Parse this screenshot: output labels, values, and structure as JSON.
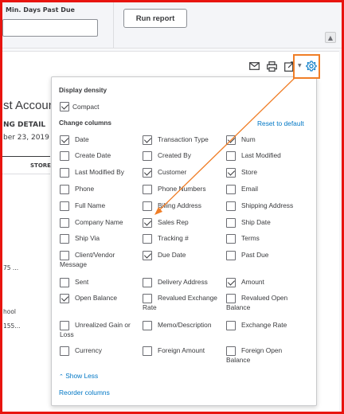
{
  "filters": {
    "min_days_label": "Min. Days Past Due",
    "min_days_value": "",
    "run_report_label": "Run report"
  },
  "toolbar": {
    "icons": [
      "email-icon",
      "print-icon",
      "export-icon",
      "settings-icon"
    ],
    "scroll_up_glyph": "▲"
  },
  "report": {
    "title_fragment": "st Accoun",
    "subtitle_fragment": "NG DETAIL",
    "date_fragment": "ber 23, 2019",
    "column_store": "STORE",
    "cell_1": "75 ...",
    "cell_2": "hool",
    "cell_3": "155..."
  },
  "popup": {
    "display_density_title": "Display density",
    "compact_label": "Compact",
    "compact_checked": true,
    "change_columns_title": "Change columns",
    "reset_label": "Reset to default",
    "show_less_label": "Show Less",
    "reorder_label": "Reorder columns",
    "options": [
      {
        "label": "Date",
        "checked": true
      },
      {
        "label": "Transaction Type",
        "checked": true
      },
      {
        "label": "Num",
        "checked": true
      },
      {
        "label": "Create Date",
        "checked": false
      },
      {
        "label": "Created By",
        "checked": false
      },
      {
        "label": "Last Modified",
        "checked": false
      },
      {
        "label": "Last Modified By",
        "checked": false
      },
      {
        "label": "Customer",
        "checked": true
      },
      {
        "label": "Store",
        "checked": true
      },
      {
        "label": "Phone",
        "checked": false
      },
      {
        "label": "Phone Numbers",
        "checked": false
      },
      {
        "label": "Email",
        "checked": false
      },
      {
        "label": "Full Name",
        "checked": false
      },
      {
        "label": "Billing Address",
        "checked": false
      },
      {
        "label": "Shipping Address",
        "checked": false
      },
      {
        "label": "Company Name",
        "checked": false
      },
      {
        "label": "Sales Rep",
        "checked": true
      },
      {
        "label": "Ship Date",
        "checked": false
      },
      {
        "label": "Ship Via",
        "checked": false
      },
      {
        "label": "Tracking #",
        "checked": false
      },
      {
        "label": "Terms",
        "checked": false
      },
      {
        "label": "Client/Vendor Message",
        "checked": false
      },
      {
        "label": "Due Date",
        "checked": true
      },
      {
        "label": "Past Due",
        "checked": false
      },
      {
        "label": "Sent",
        "checked": false
      },
      {
        "label": "Delivery Address",
        "checked": false
      },
      {
        "label": "Amount",
        "checked": true
      },
      {
        "label": "Open Balance",
        "checked": true
      },
      {
        "label": "Revalued Exchange Rate",
        "checked": false
      },
      {
        "label": "Revalued Open Balance",
        "checked": false
      },
      {
        "label": "Unrealized Gain or Loss",
        "checked": false
      },
      {
        "label": "Memo/Description",
        "checked": false
      },
      {
        "label": "Exchange Rate",
        "checked": false
      },
      {
        "label": "Currency",
        "checked": false
      },
      {
        "label": "Foreign Amount",
        "checked": false
      },
      {
        "label": "Foreign Open Balance",
        "checked": false
      }
    ]
  },
  "colors": {
    "frame": "#e8140f",
    "highlight": "#f07e27",
    "link": "#0077c5",
    "text": "#393a3d"
  }
}
